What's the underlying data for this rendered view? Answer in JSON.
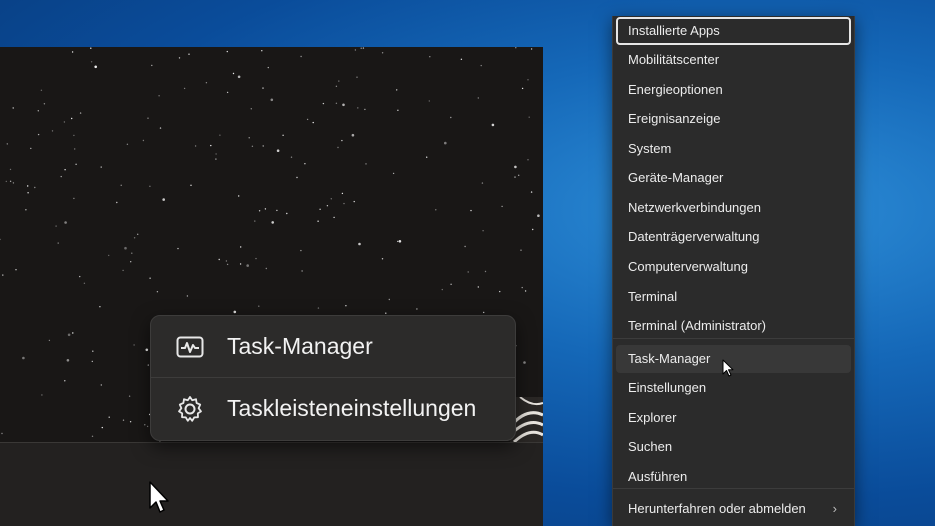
{
  "taskbar_menu": {
    "items": [
      {
        "label": "Task-Manager",
        "icon": "task-manager-icon"
      },
      {
        "label": "Taskleisteneinstellungen",
        "icon": "gear-icon"
      }
    ]
  },
  "winx_menu": {
    "items": [
      {
        "label": "Installierte Apps",
        "state": "focused"
      },
      {
        "label": "Mobilitätscenter"
      },
      {
        "label": "Energieoptionen"
      },
      {
        "label": "Ereignisanzeige"
      },
      {
        "label": "System"
      },
      {
        "label": "Geräte-Manager"
      },
      {
        "label": "Netzwerkverbindungen"
      },
      {
        "label": "Datenträgerverwaltung"
      },
      {
        "label": "Computerverwaltung"
      },
      {
        "label": "Terminal"
      },
      {
        "label": "Terminal (Administrator)"
      },
      {
        "label": "Task-Manager",
        "state": "hover"
      },
      {
        "label": "Einstellungen"
      },
      {
        "label": "Explorer"
      },
      {
        "label": "Suchen"
      },
      {
        "label": "Ausführen"
      },
      {
        "label": "Herunterfahren oder abmelden",
        "submenu": true
      }
    ],
    "submenu_chevron": "›"
  },
  "colors": {
    "desktop_blue": "#1568b8",
    "menu_bg": "#2b2b2b",
    "focus_ring": "#e6e6e6"
  }
}
